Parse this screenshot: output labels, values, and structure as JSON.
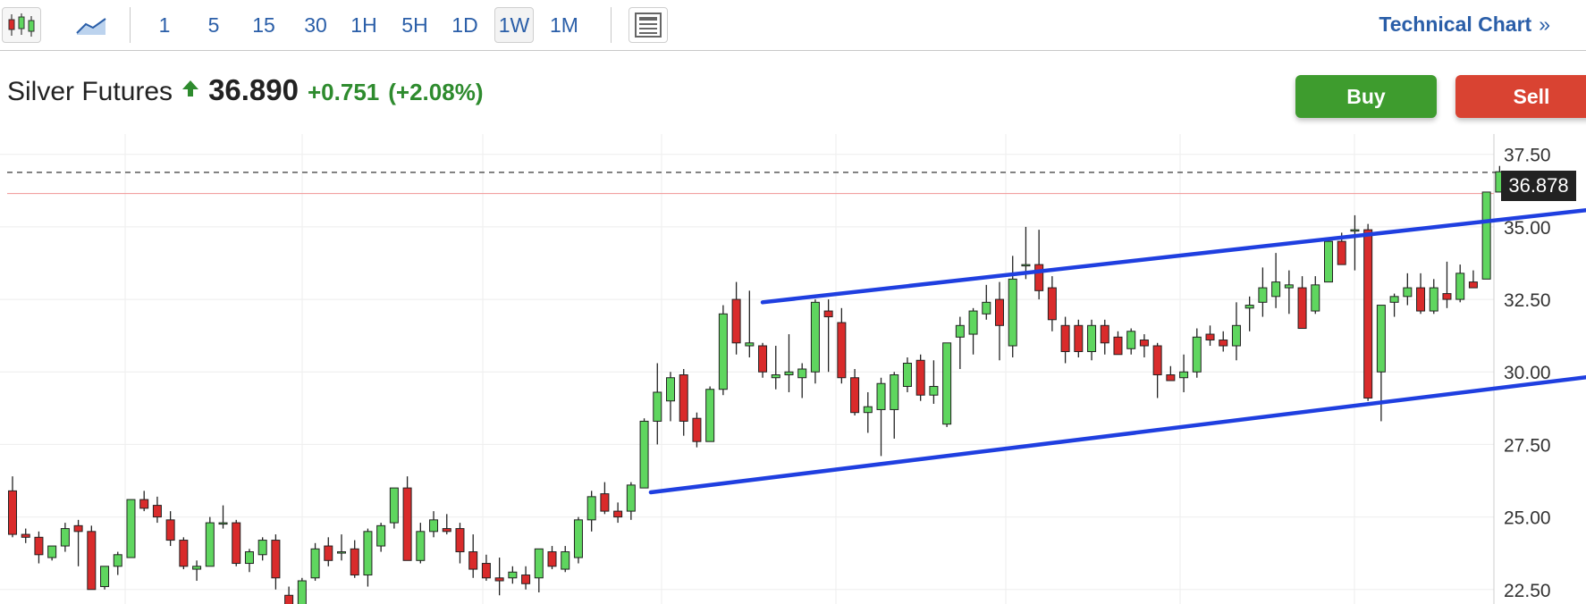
{
  "toolbar": {
    "intervals": [
      {
        "label": "1",
        "active": false
      },
      {
        "label": "5",
        "active": false
      },
      {
        "label": "15",
        "active": false
      },
      {
        "label": "30",
        "active": false
      },
      {
        "label": "1H",
        "active": false
      },
      {
        "label": "5H",
        "active": false
      },
      {
        "label": "1D",
        "active": false
      },
      {
        "label": "1W",
        "active": true
      },
      {
        "label": "1M",
        "active": false
      }
    ],
    "icons": [
      "candlestick-icon",
      "area-chart-icon",
      "layout-icon"
    ],
    "technical_chart_label": "Technical Chart",
    "technical_chart_arrow": "»"
  },
  "quote": {
    "name": "Silver Futures",
    "price": "36.890",
    "change": "+0.751",
    "change_pct": "(+2.08%)",
    "up_color": "#2e8b2e"
  },
  "actions": {
    "buy_label": "Buy",
    "sell_label": "Sell"
  },
  "colors": {
    "bull": "#5fd65f",
    "bear": "#d92b2b",
    "channel": "#1f3fe0",
    "buy": "#3e9c2e",
    "sell": "#d94332"
  },
  "chart_data": {
    "type": "candlestick",
    "symbol": "Silver Futures",
    "interval": "1W",
    "ylim": [
      22,
      38.2
    ],
    "y_ticks": [
      "22.50",
      "25.00",
      "27.50",
      "30.00",
      "32.50",
      "35.00",
      "37.50"
    ],
    "last_price_label": "36.878",
    "last_price": 36.878,
    "reference_line": 36.15,
    "grid": true,
    "candles": [
      [
        25.9,
        26.4,
        24.3,
        24.4
      ],
      [
        24.4,
        24.6,
        24.1,
        24.3
      ],
      [
        24.3,
        24.5,
        23.4,
        23.7
      ],
      [
        23.6,
        24.0,
        23.5,
        24.0
      ],
      [
        24.0,
        24.8,
        23.8,
        24.6
      ],
      [
        24.7,
        24.9,
        23.3,
        24.5
      ],
      [
        24.5,
        24.7,
        22.5,
        22.5
      ],
      [
        22.6,
        23.3,
        22.5,
        23.3
      ],
      [
        23.3,
        23.8,
        23.0,
        23.7
      ],
      [
        23.6,
        25.6,
        23.6,
        25.6
      ],
      [
        25.6,
        25.9,
        25.2,
        25.3
      ],
      [
        25.4,
        25.7,
        24.8,
        25.0
      ],
      [
        24.9,
        25.2,
        24.0,
        24.2
      ],
      [
        24.2,
        24.3,
        23.2,
        23.3
      ],
      [
        23.2,
        23.5,
        22.8,
        23.3
      ],
      [
        23.3,
        25.0,
        23.3,
        24.8
      ],
      [
        24.8,
        25.4,
        24.6,
        24.8
      ],
      [
        24.8,
        24.9,
        23.3,
        23.4
      ],
      [
        23.4,
        23.9,
        23.1,
        23.8
      ],
      [
        23.7,
        24.3,
        23.5,
        24.2
      ],
      [
        24.2,
        24.4,
        22.5,
        22.9
      ],
      [
        22.3,
        22.6,
        21.8,
        21.9
      ],
      [
        21.9,
        22.9,
        21.8,
        22.8
      ],
      [
        22.9,
        24.1,
        22.8,
        23.9
      ],
      [
        24.0,
        24.3,
        23.3,
        23.5
      ],
      [
        23.8,
        24.4,
        23.5,
        23.8
      ],
      [
        23.9,
        24.2,
        22.9,
        23.0
      ],
      [
        23.0,
        24.6,
        22.6,
        24.5
      ],
      [
        24.0,
        24.8,
        23.8,
        24.7
      ],
      [
        24.8,
        26.0,
        24.6,
        26.0
      ],
      [
        26.0,
        26.4,
        23.5,
        23.5
      ],
      [
        23.5,
        24.8,
        23.4,
        24.5
      ],
      [
        24.5,
        25.2,
        24.3,
        24.9
      ],
      [
        24.6,
        25.1,
        24.4,
        24.5
      ],
      [
        24.6,
        24.8,
        23.4,
        23.8
      ],
      [
        23.8,
        24.4,
        22.9,
        23.2
      ],
      [
        23.4,
        23.7,
        22.8,
        22.9
      ],
      [
        22.9,
        23.6,
        22.3,
        22.8
      ],
      [
        22.9,
        23.3,
        22.7,
        23.1
      ],
      [
        23.0,
        23.3,
        22.5,
        22.7
      ],
      [
        22.9,
        23.9,
        22.4,
        23.9
      ],
      [
        23.8,
        24.0,
        23.2,
        23.3
      ],
      [
        23.2,
        24.0,
        23.1,
        23.8
      ],
      [
        23.6,
        25.0,
        23.4,
        24.9
      ],
      [
        24.9,
        25.9,
        24.5,
        25.7
      ],
      [
        25.8,
        26.2,
        25.1,
        25.2
      ],
      [
        25.2,
        25.5,
        24.8,
        25.0
      ],
      [
        25.2,
        26.2,
        24.9,
        26.1
      ],
      [
        26.0,
        28.4,
        26.0,
        28.3
      ],
      [
        28.3,
        30.3,
        27.5,
        29.3
      ],
      [
        29.0,
        30.0,
        28.3,
        29.8
      ],
      [
        29.9,
        30.1,
        27.8,
        28.3
      ],
      [
        28.4,
        28.6,
        27.4,
        27.6
      ],
      [
        27.6,
        29.5,
        27.6,
        29.4
      ],
      [
        29.4,
        32.3,
        29.2,
        32.0
      ],
      [
        32.5,
        33.1,
        30.6,
        31.0
      ],
      [
        30.9,
        32.8,
        30.5,
        31.0
      ],
      [
        30.9,
        31.0,
        29.8,
        30.0
      ],
      [
        29.8,
        30.9,
        29.4,
        29.9
      ],
      [
        29.9,
        31.3,
        29.3,
        30.0
      ],
      [
        29.8,
        30.3,
        29.1,
        30.1
      ],
      [
        30.0,
        32.5,
        29.6,
        32.4
      ],
      [
        32.1,
        32.5,
        30.0,
        31.9
      ],
      [
        31.7,
        32.2,
        29.6,
        29.8
      ],
      [
        29.8,
        30.1,
        28.5,
        28.6
      ],
      [
        28.6,
        29.3,
        27.9,
        28.8
      ],
      [
        28.7,
        29.8,
        27.1,
        29.6
      ],
      [
        28.7,
        30.0,
        27.7,
        29.9
      ],
      [
        29.5,
        30.5,
        29.3,
        30.3
      ],
      [
        30.4,
        30.6,
        29.0,
        29.2
      ],
      [
        29.2,
        30.4,
        28.9,
        29.5
      ],
      [
        28.2,
        31.0,
        28.1,
        31.0
      ],
      [
        31.2,
        31.9,
        30.1,
        31.6
      ],
      [
        31.3,
        32.2,
        30.6,
        32.1
      ],
      [
        32.0,
        33.0,
        31.8,
        32.4
      ],
      [
        32.5,
        33.1,
        30.4,
        31.6
      ],
      [
        30.9,
        34.0,
        30.5,
        33.2
      ],
      [
        33.7,
        35.0,
        33.2,
        33.7
      ],
      [
        33.7,
        34.9,
        32.5,
        32.8
      ],
      [
        32.9,
        33.3,
        31.4,
        31.8
      ],
      [
        31.6,
        31.9,
        30.3,
        30.7
      ],
      [
        31.6,
        31.8,
        30.5,
        30.7
      ],
      [
        30.7,
        31.8,
        30.4,
        31.6
      ],
      [
        31.6,
        31.8,
        30.6,
        31.0
      ],
      [
        31.2,
        31.4,
        30.6,
        30.6
      ],
      [
        30.8,
        31.5,
        30.6,
        31.4
      ],
      [
        31.1,
        31.3,
        30.5,
        30.9
      ],
      [
        30.9,
        31.0,
        29.1,
        29.9
      ],
      [
        29.9,
        30.2,
        29.7,
        29.7
      ],
      [
        29.8,
        30.6,
        29.3,
        30.0
      ],
      [
        30.0,
        31.5,
        29.8,
        31.2
      ],
      [
        31.3,
        31.6,
        30.9,
        31.1
      ],
      [
        31.1,
        31.4,
        30.7,
        30.9
      ],
      [
        30.9,
        32.4,
        30.4,
        31.6
      ],
      [
        32.2,
        32.6,
        31.4,
        32.3
      ],
      [
        32.4,
        33.6,
        31.9,
        32.9
      ],
      [
        32.6,
        34.1,
        32.2,
        33.1
      ],
      [
        32.9,
        33.5,
        32.0,
        33.0
      ],
      [
        32.9,
        33.3,
        31.5,
        31.5
      ],
      [
        32.1,
        33.3,
        32.0,
        33.0
      ],
      [
        33.1,
        34.6,
        33.1,
        34.5
      ],
      [
        34.5,
        34.8,
        33.7,
        33.7
      ],
      [
        34.9,
        35.4,
        33.5,
        34.9
      ],
      [
        34.9,
        35.1,
        29.0,
        29.1
      ],
      [
        30.0,
        32.2,
        28.3,
        32.3
      ],
      [
        32.4,
        32.7,
        31.9,
        32.6
      ],
      [
        32.6,
        33.4,
        32.3,
        32.9
      ],
      [
        32.9,
        33.4,
        32.0,
        32.1
      ],
      [
        32.1,
        33.2,
        32.0,
        32.9
      ],
      [
        32.7,
        33.8,
        32.2,
        32.5
      ],
      [
        32.5,
        33.7,
        32.4,
        33.4
      ],
      [
        33.1,
        33.5,
        32.9,
        32.9
      ],
      [
        33.2,
        36.1,
        33.2,
        36.2
      ],
      [
        36.2,
        37.1,
        36.2,
        36.9
      ]
    ],
    "trendlines": [
      {
        "from": [
          48.5,
          25.85
        ],
        "to": [
          122,
          29.95
        ]
      },
      {
        "from": [
          57,
          32.4
        ],
        "to": [
          123,
          35.75
        ]
      }
    ]
  }
}
